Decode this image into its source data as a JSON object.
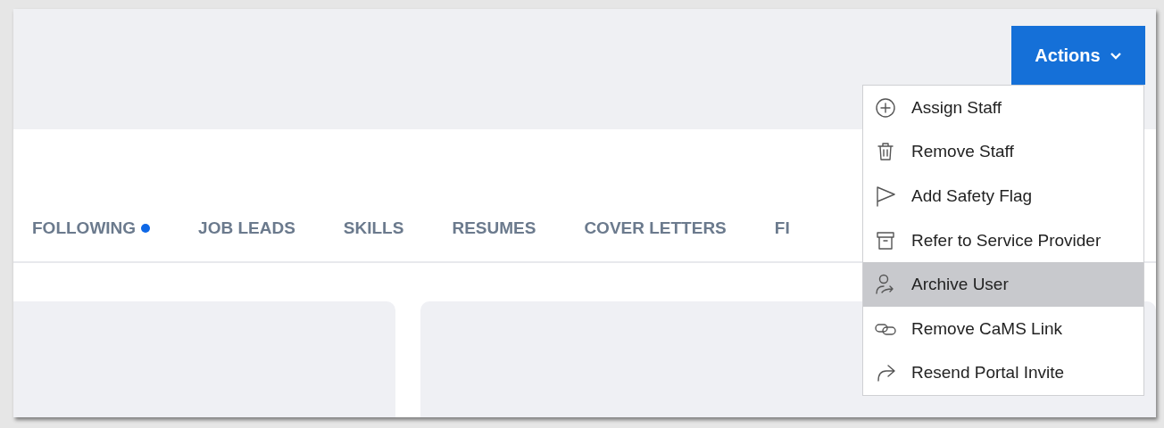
{
  "actions_button": {
    "label": "Actions",
    "expanded": true
  },
  "actions_menu": [
    {
      "label": "Assign Staff",
      "selected": false
    },
    {
      "label": "Remove Staff",
      "selected": false
    },
    {
      "label": "Add Safety Flag",
      "selected": false
    },
    {
      "label": "Refer to Service Provider",
      "selected": false
    },
    {
      "label": "Archive User",
      "selected": true
    },
    {
      "label": "Remove CaMS Link",
      "selected": false
    },
    {
      "label": "Resend Portal Invite",
      "selected": false
    }
  ],
  "tabs": [
    {
      "label": "FOLLOWING",
      "dot": true
    },
    {
      "label": "JOB LEADS",
      "dot": false
    },
    {
      "label": "SKILLS",
      "dot": false
    },
    {
      "label": "RESUMES",
      "dot": false
    },
    {
      "label": "COVER LETTERS",
      "dot": false
    },
    {
      "label": "FI",
      "dot": false
    }
  ]
}
